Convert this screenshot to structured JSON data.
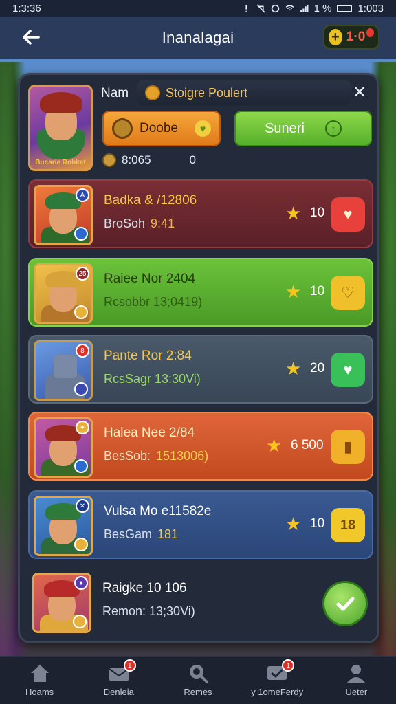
{
  "status_bar": {
    "time": "1:3:36",
    "clock_right": "1:003",
    "battery_text": "1 %"
  },
  "header": {
    "title": "Inanalagai",
    "coins_value": "1·0"
  },
  "profile": {
    "name": "Nam",
    "avatar_caption": "Bucarie Robket",
    "quest_label": "Stoigre Poulert",
    "orange_button_label": "Doobe",
    "green_button_label": "Suneri",
    "stat_value": "8:065",
    "stat_zero": "0"
  },
  "items": [
    {
      "title": "Badka & /12806",
      "sub_prefix": "BroSoh",
      "sub_highlight": "9:41",
      "rating": "10",
      "accent": "#e8403a"
    },
    {
      "title": "Raiee Nor 2404",
      "sub_prefix": "Rcsobbr 13;0419)",
      "sub_highlight": "",
      "rating": "10",
      "accent": "#f0c02a"
    },
    {
      "title": "Pante Ror 2:84",
      "sub_prefix": "RcsSagr 13:30Vi)",
      "sub_highlight": "",
      "rating": "20",
      "accent": "#3ac058"
    },
    {
      "title": "Halea Nee 2/84",
      "sub_prefix": "BesSob:",
      "sub_highlight": "1513006)",
      "rating": "6 500",
      "accent": "#f0b02a"
    },
    {
      "title": "Vulsa Mo e11582e",
      "sub_prefix": "BesGam",
      "sub_highlight": "181",
      "rating": "10",
      "accent": "#f0c82a"
    },
    {
      "title": "Raigke 10 106",
      "sub_prefix": "Remon: 13;30Vi)",
      "sub_highlight": "",
      "rating": "",
      "accent": "#6ac83a"
    }
  ],
  "item6_action_icon": "check-icon",
  "bottom_nav": [
    {
      "label": "Hoams",
      "icon": "home-icon"
    },
    {
      "label": "Denleia",
      "icon": "mail-icon",
      "badge": "1"
    },
    {
      "label": "Remes",
      "icon": "search-icon"
    },
    {
      "label": "y 1omeFerdy",
      "icon": "messages-icon",
      "badge": "1"
    },
    {
      "label": "Ueter",
      "icon": "profile-icon"
    }
  ],
  "colors": {
    "header_bg": "#2b3b5c",
    "panel_bg": "#232b3a",
    "gold": "#f7c51e"
  }
}
